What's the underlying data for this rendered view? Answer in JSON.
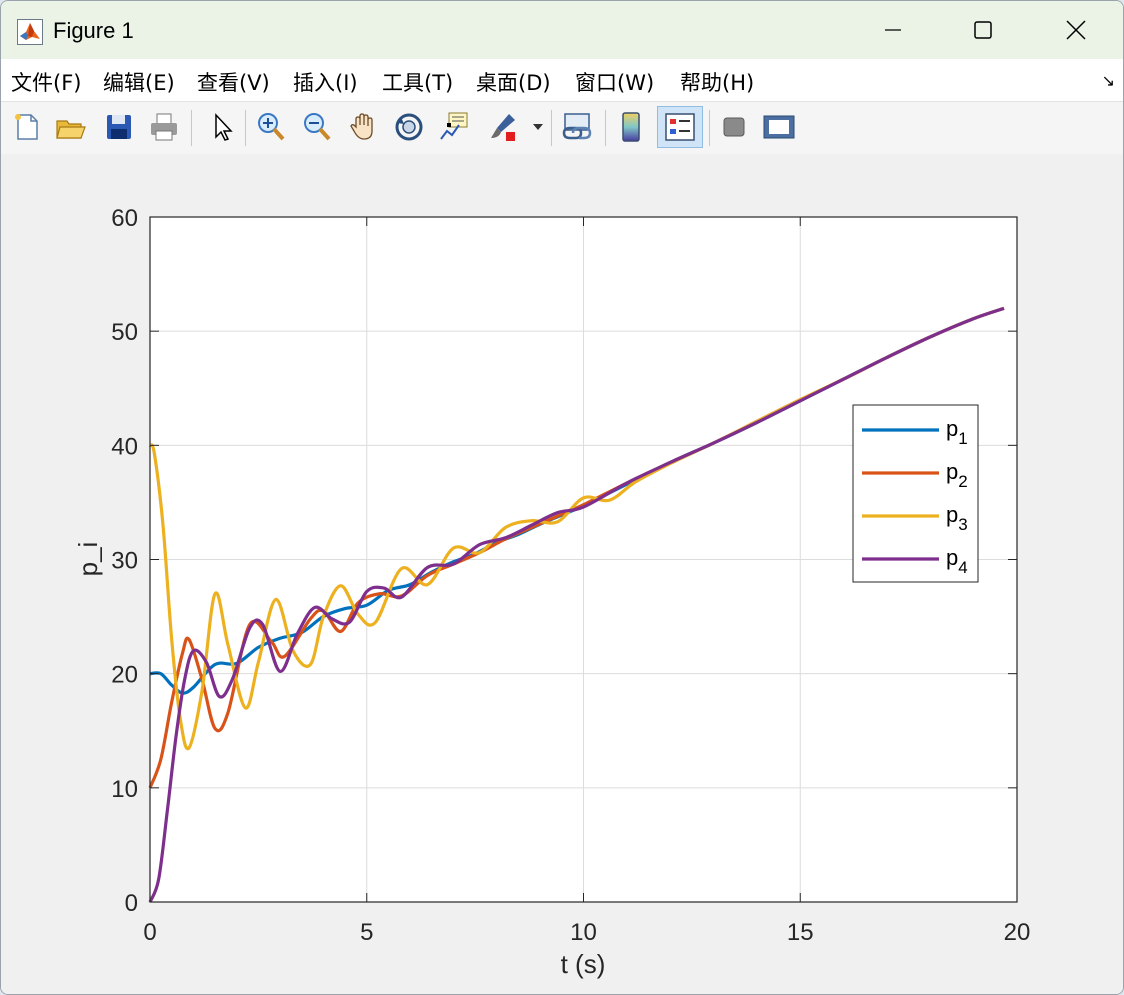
{
  "window": {
    "title": "Figure 1"
  },
  "menu": {
    "items": [
      "文件(F)",
      "编辑(E)",
      "查看(V)",
      "插入(I)",
      "工具(T)",
      "桌面(D)",
      "窗口(W)",
      "帮助(H)"
    ]
  },
  "toolbar": {
    "buttons": [
      "new-figure-icon",
      "open-file-icon",
      "save-icon",
      "print-icon",
      "pointer-icon",
      "zoom-in-icon",
      "zoom-out-icon",
      "pan-hand-icon",
      "rotate-3d-icon",
      "data-cursor-icon",
      "brush-icon",
      "brush-dropdown-icon",
      "link-plot-icon",
      "colorbar-icon",
      "legend-icon",
      "hide-plot-tools-icon",
      "show-plot-tools-icon"
    ],
    "active": "legend-icon"
  },
  "chart_data": {
    "type": "line",
    "xlabel": "t (s)",
    "ylabel": "p_i",
    "xlim": [
      0,
      20
    ],
    "ylim": [
      0,
      60
    ],
    "xticks": [
      0,
      5,
      10,
      15,
      20
    ],
    "yticks": [
      0,
      10,
      20,
      30,
      40,
      50,
      60
    ],
    "grid": true,
    "legend_position": "right",
    "series": [
      {
        "name": "p",
        "subscript": "1",
        "color": "#0072BD",
        "x": [
          0,
          0.25,
          0.5,
          0.75,
          1,
          1.5,
          2,
          2.5,
          3,
          3.5,
          4,
          4.5,
          5,
          5.5,
          6,
          6.5,
          7,
          7.5,
          8,
          8.5,
          9,
          9.5,
          10,
          11,
          12,
          13,
          14,
          15,
          16,
          17,
          18,
          19,
          19.7
        ],
        "y": [
          20,
          20,
          19,
          18.3,
          18.8,
          20.8,
          20.9,
          22.3,
          23.1,
          23.6,
          25,
          25.7,
          26,
          27.3,
          27.8,
          28.9,
          29.8,
          30.5,
          31.5,
          32.2,
          33.1,
          33.9,
          34.7,
          36.6,
          38.5,
          40.2,
          42,
          43.9,
          45.8,
          47.7,
          49.5,
          51.1,
          52
        ]
      },
      {
        "name": "p",
        "subscript": "2",
        "color": "#D95319",
        "x": [
          0,
          0.25,
          0.5,
          0.75,
          0.9,
          1.2,
          1.5,
          1.8,
          2.3,
          2.8,
          3.1,
          3.7,
          4.0,
          4.4,
          4.8,
          5.3,
          5.8,
          6.4,
          7.0,
          7.6,
          8.2,
          8.8,
          9.4,
          10,
          11,
          12,
          13,
          14,
          15,
          16,
          17,
          18,
          19,
          19.7
        ],
        "y": [
          10,
          12.5,
          17.5,
          21.8,
          23,
          19.5,
          15.2,
          16.6,
          24.3,
          22.8,
          21.5,
          24.8,
          25.5,
          23.7,
          26.2,
          27,
          26.8,
          28.6,
          29.6,
          30.6,
          31.8,
          32.8,
          33.8,
          34.8,
          36.7,
          38.5,
          40.2,
          42.1,
          44,
          45.8,
          47.7,
          49.5,
          51.1,
          52
        ]
      },
      {
        "name": "p",
        "subscript": "3",
        "color": "#EDB120",
        "x": [
          0,
          0.1,
          0.3,
          0.5,
          0.7,
          0.9,
          1.2,
          1.5,
          1.8,
          2.2,
          2.5,
          2.9,
          3.3,
          3.7,
          4.0,
          4.4,
          4.8,
          5.2,
          5.8,
          6.4,
          7.0,
          7.6,
          8.2,
          8.8,
          9.4,
          10,
          10.6,
          11.2,
          12,
          13,
          14,
          15,
          16,
          17,
          18,
          19,
          19.7
        ],
        "y": [
          40,
          39.3,
          33,
          23,
          16,
          13.5,
          18.5,
          27,
          22.5,
          17,
          21,
          26.5,
          22,
          20.8,
          25,
          27.7,
          25.2,
          24.5,
          29.2,
          27.8,
          31,
          30.6,
          32.8,
          33.4,
          33.3,
          35.4,
          35.2,
          36.8,
          38.4,
          40.2,
          42.1,
          44,
          45.8,
          47.7,
          49.5,
          51.1,
          52
        ]
      },
      {
        "name": "p",
        "subscript": "4",
        "color": "#7E2F8E",
        "x": [
          0,
          0.2,
          0.4,
          0.6,
          0.8,
          1.0,
          1.3,
          1.6,
          1.9,
          2.3,
          2.6,
          3.0,
          3.4,
          3.8,
          4.2,
          4.6,
          5.0,
          5.4,
          5.8,
          6.4,
          7.0,
          7.6,
          8.2,
          8.8,
          9.4,
          10,
          11,
          12,
          13,
          14,
          15,
          16,
          17,
          18,
          19,
          19.7
        ],
        "y": [
          0,
          2,
          8,
          14.5,
          19.5,
          22,
          21,
          18,
          19.5,
          24,
          24.3,
          20.2,
          23.5,
          25.8,
          24.8,
          24.5,
          27.2,
          27.5,
          26.7,
          29.3,
          29.6,
          31.3,
          31.9,
          33,
          34.1,
          34.6,
          36.7,
          38.5,
          40.2,
          42,
          43.9,
          45.8,
          47.7,
          49.5,
          51.1,
          52
        ]
      }
    ]
  }
}
